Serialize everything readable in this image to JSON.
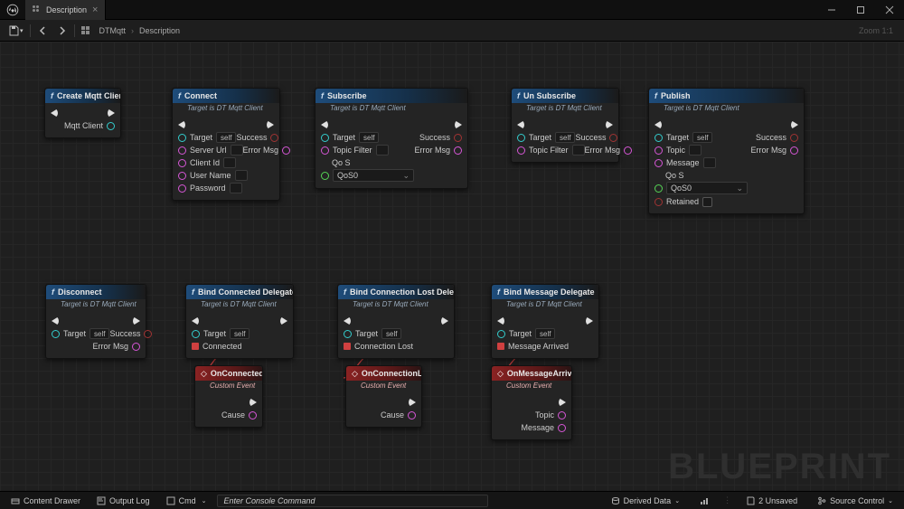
{
  "window": {
    "tab_title": "Description"
  },
  "window_controls": {
    "min": "–",
    "max": "▢",
    "close": "✕"
  },
  "breadcrumb": {
    "root": "DTMqtt",
    "current": "Description",
    "zoom": "Zoom 1:1"
  },
  "watermark": "BLUEPRINT",
  "nodes": {
    "create": {
      "title": "Create Mqtt Client",
      "out_mqtt": "Mqtt Client"
    },
    "connect": {
      "title": "Connect",
      "subtitle": "Target is DT Mqtt Client",
      "target": "Target",
      "target_val": "self",
      "server_url": "Server Url",
      "client_id": "Client Id",
      "user_name": "User Name",
      "password": "Password",
      "success": "Success",
      "error": "Error Msg"
    },
    "subscribe": {
      "title": "Subscribe",
      "subtitle": "Target is DT Mqtt Client",
      "target": "Target",
      "target_val": "self",
      "topic_filter": "Topic Filter",
      "qos": "Qo S",
      "qos_val": "QoS0",
      "success": "Success",
      "error": "Error Msg"
    },
    "unsubscribe": {
      "title": "Un Subscribe",
      "subtitle": "Target is DT Mqtt Client",
      "target": "Target",
      "target_val": "self",
      "topic_filter": "Topic Filter",
      "success": "Success",
      "error": "Error Msg"
    },
    "publish": {
      "title": "Publish",
      "subtitle": "Target is DT Mqtt Client",
      "target": "Target",
      "target_val": "self",
      "topic": "Topic",
      "message": "Message",
      "qos": "Qo S",
      "qos_val": "QoS0",
      "retained": "Retained",
      "success": "Success",
      "error": "Error Msg"
    },
    "disconnect": {
      "title": "Disconnect",
      "subtitle": "Target is DT Mqtt Client",
      "target": "Target",
      "target_val": "self",
      "success": "Success",
      "error": "Error Msg"
    },
    "bind_connected": {
      "title": "Bind Connected Delegate",
      "subtitle": "Target is DT Mqtt Client",
      "target": "Target",
      "target_val": "self",
      "connected": "Connected"
    },
    "bind_connlost": {
      "title": "Bind Connection Lost Delegate",
      "subtitle": "Target is DT Mqtt Client",
      "target": "Target",
      "target_val": "self",
      "connlost": "Connection Lost"
    },
    "bind_msg": {
      "title": "Bind Message Delegate",
      "subtitle": "Target is DT Mqtt Client",
      "target": "Target",
      "target_val": "self",
      "msgarrived": "Message Arrived"
    },
    "evt_connected": {
      "title": "OnConnected",
      "subtitle": "Custom Event",
      "cause": "Cause"
    },
    "evt_connlost": {
      "title": "OnConnectionLost",
      "subtitle": "Custom Event",
      "cause": "Cause"
    },
    "evt_msg": {
      "title": "OnMessageArrived",
      "subtitle": "Custom Event",
      "topic": "Topic",
      "message": "Message"
    }
  },
  "footer": {
    "content_drawer": "Content Drawer",
    "output_log": "Output Log",
    "cmd": "Cmd",
    "console_placeholder": "Enter Console Command",
    "derived_data": "Derived Data",
    "unsaved": "2 Unsaved",
    "source_control": "Source Control"
  }
}
